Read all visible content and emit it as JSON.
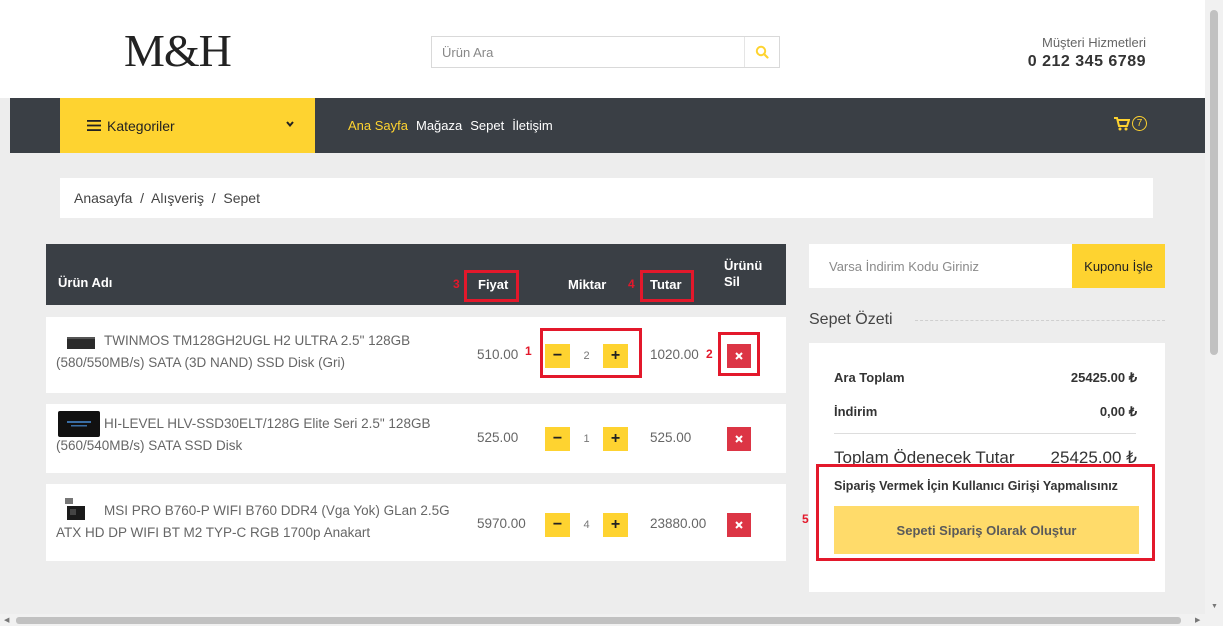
{
  "header": {
    "logo": "M&H",
    "search_placeholder": "Ürün Ara",
    "customer_service_label": "Müşteri Hizmetleri",
    "customer_service_phone": "0 212 345 6789"
  },
  "nav": {
    "categories_label": "Kategoriler",
    "links": [
      "Ana Sayfa",
      "Mağaza",
      "Sepet",
      "İletişim"
    ],
    "cart_count": "7"
  },
  "breadcrumb": "Anasayfa  /  Alışveriş  /  Sepet",
  "table": {
    "headers": {
      "product": "Ürün Adı",
      "price": "Fiyat",
      "quantity": "Miktar",
      "total": "Tutar",
      "delete": "Ürünü Sil"
    },
    "rows": [
      {
        "name": "TWINMOS TM128GH2UGL H2 ULTRA 2.5\" 128GB (580/550MB/s) SATA (3D NAND) SSD Disk (Gri)",
        "price": "510.00",
        "qty": "2",
        "total": "1020.00"
      },
      {
        "name": "HI-LEVEL HLV-SSD30ELT/128G Elite Seri 2.5\" 128GB (560/540MB/s) SATA SSD Disk",
        "price": "525.00",
        "qty": "1",
        "total": "525.00"
      },
      {
        "name": "MSI PRO B760-P WIFI B760 DDR4 (Vga Yok) GLan 2.5G ATX HD DP WIFI BT M2 TYP-C RGB 1700p Anakart",
        "price": "5970.00",
        "qty": "4",
        "total": "23880.00"
      }
    ]
  },
  "sidebar": {
    "coupon_placeholder": "Varsa İndirim Kodu Giriniz",
    "coupon_button": "Kuponu İşle",
    "summary_title": "Sepet Özeti",
    "subtotal_label": "Ara Toplam",
    "subtotal_value": "25425.00 ₺",
    "discount_label": "İndirim",
    "discount_value": "0,00 ₺",
    "total_label": "Toplam Ödenecek Tutar",
    "total_value": "25425.00 ₺",
    "login_warning": "Sipariş Vermek İçin Kullanıcı Girişi Yapmalısınız",
    "order_button": "Sepeti Sipariş Olarak Oluştur"
  },
  "annotations": [
    "1",
    "2",
    "3",
    "4",
    "5"
  ],
  "colors": {
    "accent": "#fed330",
    "dark": "#3a3f45",
    "danger": "#dc3545",
    "annotation": "#e3182b"
  }
}
